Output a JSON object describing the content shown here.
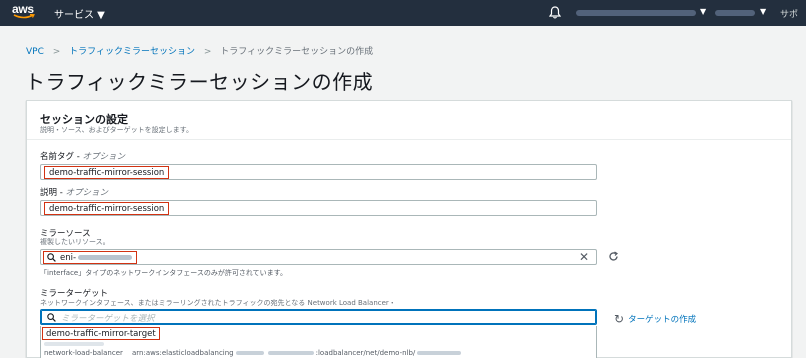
{
  "nav": {
    "logo": "aws",
    "services_label": "サービス ▼",
    "caret": "▼",
    "right_label": "サポ"
  },
  "breadcrumb": {
    "items": [
      "VPC",
      "トラフィックミラーセッション",
      "トラフィックミラーセッションの作成"
    ],
    "separator": ">"
  },
  "page_title": "トラフィックミラーセッションの作成",
  "session_settings": {
    "title": "セッションの設定",
    "description": "説明・ソース、およびターゲットを設定します。",
    "name_tag": {
      "label": "名前タグ - ",
      "optional": "オプション",
      "value": "demo-traffic-mirror-session"
    },
    "description_field": {
      "label": "説明 - ",
      "optional": "オプション",
      "value": "demo-traffic-mirror-session"
    },
    "mirror_source": {
      "label": "ミラーソース",
      "sublabel": "複製したいリソース。",
      "value_prefix": "eni-",
      "clear": "✕",
      "hint": "「interface」タイプのネットワークインタフェースのみが許可されています。"
    },
    "mirror_target": {
      "label": "ミラーターゲット",
      "sublabel": "ネットワークインタフェース、またはミラーリングされたトラフィックの宛先となる Network Load Balancer・",
      "placeholder": "ミラーターゲットを選択",
      "create_link": "ターゲットの作成",
      "dropdown": {
        "option_name": "demo-traffic-mirror-target",
        "option_type": "network-load-balancer",
        "arn_prefix": "arn:aws:elasticloadbalancing",
        "arn_suffix": ":loadbalancer/net/demo-nlb/"
      }
    }
  },
  "colors": {
    "nav_bg": "#232f3e",
    "link": "#0073bb",
    "highlight": "#d13212",
    "aws_orange": "#ff9900"
  }
}
